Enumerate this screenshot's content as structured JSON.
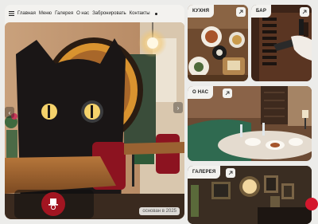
{
  "nav": {
    "links": [
      "Главная",
      "Меню",
      "Галерея",
      "О нас",
      "Забронировать",
      "Контакты"
    ]
  },
  "hero": {
    "founded": "основан в 2025"
  },
  "cards": {
    "kitchen": "КУХНЯ",
    "bar": "БАР",
    "about": "О НАС",
    "gallery": "ГАЛЕРЕЯ"
  },
  "colors": {
    "background": "#ececea",
    "panel": "#f3f2ef",
    "accent_red": "#a21521",
    "bright_red": "#d4172d"
  },
  "icons": [
    "hamburger-menu-icon",
    "arrow-up-right-icon",
    "chevron-left-icon",
    "chevron-right-icon",
    "top-hat-logo-icon"
  ]
}
